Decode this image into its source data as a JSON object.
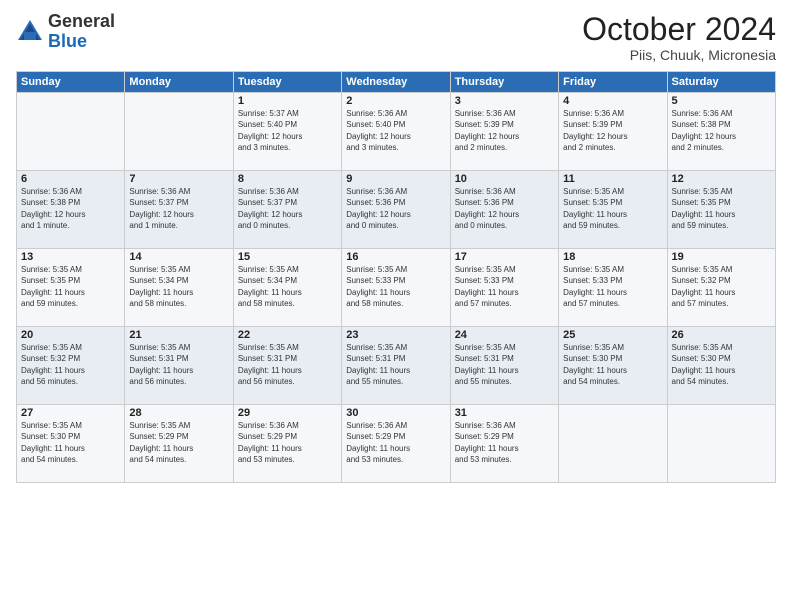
{
  "logo": {
    "general": "General",
    "blue": "Blue"
  },
  "header": {
    "month": "October 2024",
    "location": "Piis, Chuuk, Micronesia"
  },
  "weekdays": [
    "Sunday",
    "Monday",
    "Tuesday",
    "Wednesday",
    "Thursday",
    "Friday",
    "Saturday"
  ],
  "weeks": [
    [
      {
        "day": "",
        "info": ""
      },
      {
        "day": "",
        "info": ""
      },
      {
        "day": "1",
        "info": "Sunrise: 5:37 AM\nSunset: 5:40 PM\nDaylight: 12 hours\nand 3 minutes."
      },
      {
        "day": "2",
        "info": "Sunrise: 5:36 AM\nSunset: 5:40 PM\nDaylight: 12 hours\nand 3 minutes."
      },
      {
        "day": "3",
        "info": "Sunrise: 5:36 AM\nSunset: 5:39 PM\nDaylight: 12 hours\nand 2 minutes."
      },
      {
        "day": "4",
        "info": "Sunrise: 5:36 AM\nSunset: 5:39 PM\nDaylight: 12 hours\nand 2 minutes."
      },
      {
        "day": "5",
        "info": "Sunrise: 5:36 AM\nSunset: 5:38 PM\nDaylight: 12 hours\nand 2 minutes."
      }
    ],
    [
      {
        "day": "6",
        "info": "Sunrise: 5:36 AM\nSunset: 5:38 PM\nDaylight: 12 hours\nand 1 minute."
      },
      {
        "day": "7",
        "info": "Sunrise: 5:36 AM\nSunset: 5:37 PM\nDaylight: 12 hours\nand 1 minute."
      },
      {
        "day": "8",
        "info": "Sunrise: 5:36 AM\nSunset: 5:37 PM\nDaylight: 12 hours\nand 0 minutes."
      },
      {
        "day": "9",
        "info": "Sunrise: 5:36 AM\nSunset: 5:36 PM\nDaylight: 12 hours\nand 0 minutes."
      },
      {
        "day": "10",
        "info": "Sunrise: 5:36 AM\nSunset: 5:36 PM\nDaylight: 12 hours\nand 0 minutes."
      },
      {
        "day": "11",
        "info": "Sunrise: 5:35 AM\nSunset: 5:35 PM\nDaylight: 11 hours\nand 59 minutes."
      },
      {
        "day": "12",
        "info": "Sunrise: 5:35 AM\nSunset: 5:35 PM\nDaylight: 11 hours\nand 59 minutes."
      }
    ],
    [
      {
        "day": "13",
        "info": "Sunrise: 5:35 AM\nSunset: 5:35 PM\nDaylight: 11 hours\nand 59 minutes."
      },
      {
        "day": "14",
        "info": "Sunrise: 5:35 AM\nSunset: 5:34 PM\nDaylight: 11 hours\nand 58 minutes."
      },
      {
        "day": "15",
        "info": "Sunrise: 5:35 AM\nSunset: 5:34 PM\nDaylight: 11 hours\nand 58 minutes."
      },
      {
        "day": "16",
        "info": "Sunrise: 5:35 AM\nSunset: 5:33 PM\nDaylight: 11 hours\nand 58 minutes."
      },
      {
        "day": "17",
        "info": "Sunrise: 5:35 AM\nSunset: 5:33 PM\nDaylight: 11 hours\nand 57 minutes."
      },
      {
        "day": "18",
        "info": "Sunrise: 5:35 AM\nSunset: 5:33 PM\nDaylight: 11 hours\nand 57 minutes."
      },
      {
        "day": "19",
        "info": "Sunrise: 5:35 AM\nSunset: 5:32 PM\nDaylight: 11 hours\nand 57 minutes."
      }
    ],
    [
      {
        "day": "20",
        "info": "Sunrise: 5:35 AM\nSunset: 5:32 PM\nDaylight: 11 hours\nand 56 minutes."
      },
      {
        "day": "21",
        "info": "Sunrise: 5:35 AM\nSunset: 5:31 PM\nDaylight: 11 hours\nand 56 minutes."
      },
      {
        "day": "22",
        "info": "Sunrise: 5:35 AM\nSunset: 5:31 PM\nDaylight: 11 hours\nand 56 minutes."
      },
      {
        "day": "23",
        "info": "Sunrise: 5:35 AM\nSunset: 5:31 PM\nDaylight: 11 hours\nand 55 minutes."
      },
      {
        "day": "24",
        "info": "Sunrise: 5:35 AM\nSunset: 5:31 PM\nDaylight: 11 hours\nand 55 minutes."
      },
      {
        "day": "25",
        "info": "Sunrise: 5:35 AM\nSunset: 5:30 PM\nDaylight: 11 hours\nand 54 minutes."
      },
      {
        "day": "26",
        "info": "Sunrise: 5:35 AM\nSunset: 5:30 PM\nDaylight: 11 hours\nand 54 minutes."
      }
    ],
    [
      {
        "day": "27",
        "info": "Sunrise: 5:35 AM\nSunset: 5:30 PM\nDaylight: 11 hours\nand 54 minutes."
      },
      {
        "day": "28",
        "info": "Sunrise: 5:35 AM\nSunset: 5:29 PM\nDaylight: 11 hours\nand 54 minutes."
      },
      {
        "day": "29",
        "info": "Sunrise: 5:36 AM\nSunset: 5:29 PM\nDaylight: 11 hours\nand 53 minutes."
      },
      {
        "day": "30",
        "info": "Sunrise: 5:36 AM\nSunset: 5:29 PM\nDaylight: 11 hours\nand 53 minutes."
      },
      {
        "day": "31",
        "info": "Sunrise: 5:36 AM\nSunset: 5:29 PM\nDaylight: 11 hours\nand 53 minutes."
      },
      {
        "day": "",
        "info": ""
      },
      {
        "day": "",
        "info": ""
      }
    ]
  ]
}
